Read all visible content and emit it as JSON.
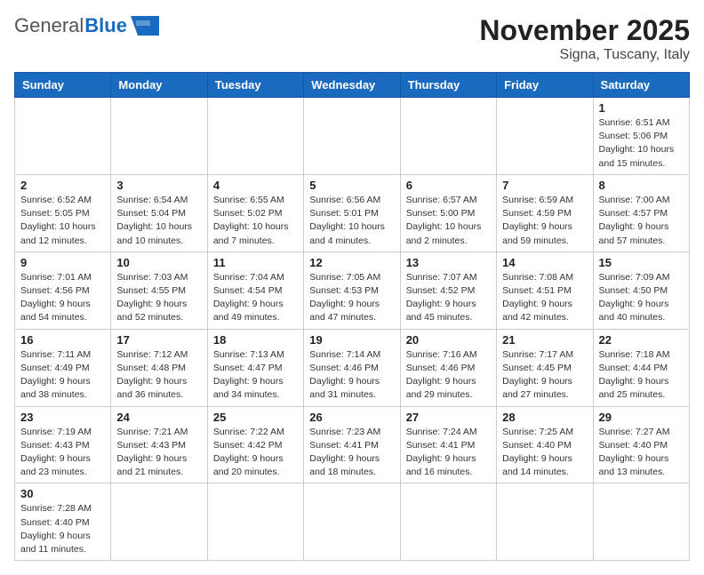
{
  "logo": {
    "general": "General",
    "blue": "Blue"
  },
  "title": "November 2025",
  "subtitle": "Signa, Tuscany, Italy",
  "weekdays": [
    "Sunday",
    "Monday",
    "Tuesday",
    "Wednesday",
    "Thursday",
    "Friday",
    "Saturday"
  ],
  "weeks": [
    [
      {
        "day": "",
        "info": ""
      },
      {
        "day": "",
        "info": ""
      },
      {
        "day": "",
        "info": ""
      },
      {
        "day": "",
        "info": ""
      },
      {
        "day": "",
        "info": ""
      },
      {
        "day": "",
        "info": ""
      },
      {
        "day": "1",
        "info": "Sunrise: 6:51 AM\nSunset: 5:06 PM\nDaylight: 10 hours and 15 minutes."
      }
    ],
    [
      {
        "day": "2",
        "info": "Sunrise: 6:52 AM\nSunset: 5:05 PM\nDaylight: 10 hours and 12 minutes."
      },
      {
        "day": "3",
        "info": "Sunrise: 6:54 AM\nSunset: 5:04 PM\nDaylight: 10 hours and 10 minutes."
      },
      {
        "day": "4",
        "info": "Sunrise: 6:55 AM\nSunset: 5:02 PM\nDaylight: 10 hours and 7 minutes."
      },
      {
        "day": "5",
        "info": "Sunrise: 6:56 AM\nSunset: 5:01 PM\nDaylight: 10 hours and 4 minutes."
      },
      {
        "day": "6",
        "info": "Sunrise: 6:57 AM\nSunset: 5:00 PM\nDaylight: 10 hours and 2 minutes."
      },
      {
        "day": "7",
        "info": "Sunrise: 6:59 AM\nSunset: 4:59 PM\nDaylight: 9 hours and 59 minutes."
      },
      {
        "day": "8",
        "info": "Sunrise: 7:00 AM\nSunset: 4:57 PM\nDaylight: 9 hours and 57 minutes."
      }
    ],
    [
      {
        "day": "9",
        "info": "Sunrise: 7:01 AM\nSunset: 4:56 PM\nDaylight: 9 hours and 54 minutes."
      },
      {
        "day": "10",
        "info": "Sunrise: 7:03 AM\nSunset: 4:55 PM\nDaylight: 9 hours and 52 minutes."
      },
      {
        "day": "11",
        "info": "Sunrise: 7:04 AM\nSunset: 4:54 PM\nDaylight: 9 hours and 49 minutes."
      },
      {
        "day": "12",
        "info": "Sunrise: 7:05 AM\nSunset: 4:53 PM\nDaylight: 9 hours and 47 minutes."
      },
      {
        "day": "13",
        "info": "Sunrise: 7:07 AM\nSunset: 4:52 PM\nDaylight: 9 hours and 45 minutes."
      },
      {
        "day": "14",
        "info": "Sunrise: 7:08 AM\nSunset: 4:51 PM\nDaylight: 9 hours and 42 minutes."
      },
      {
        "day": "15",
        "info": "Sunrise: 7:09 AM\nSunset: 4:50 PM\nDaylight: 9 hours and 40 minutes."
      }
    ],
    [
      {
        "day": "16",
        "info": "Sunrise: 7:11 AM\nSunset: 4:49 PM\nDaylight: 9 hours and 38 minutes."
      },
      {
        "day": "17",
        "info": "Sunrise: 7:12 AM\nSunset: 4:48 PM\nDaylight: 9 hours and 36 minutes."
      },
      {
        "day": "18",
        "info": "Sunrise: 7:13 AM\nSunset: 4:47 PM\nDaylight: 9 hours and 34 minutes."
      },
      {
        "day": "19",
        "info": "Sunrise: 7:14 AM\nSunset: 4:46 PM\nDaylight: 9 hours and 31 minutes."
      },
      {
        "day": "20",
        "info": "Sunrise: 7:16 AM\nSunset: 4:46 PM\nDaylight: 9 hours and 29 minutes."
      },
      {
        "day": "21",
        "info": "Sunrise: 7:17 AM\nSunset: 4:45 PM\nDaylight: 9 hours and 27 minutes."
      },
      {
        "day": "22",
        "info": "Sunrise: 7:18 AM\nSunset: 4:44 PM\nDaylight: 9 hours and 25 minutes."
      }
    ],
    [
      {
        "day": "23",
        "info": "Sunrise: 7:19 AM\nSunset: 4:43 PM\nDaylight: 9 hours and 23 minutes."
      },
      {
        "day": "24",
        "info": "Sunrise: 7:21 AM\nSunset: 4:43 PM\nDaylight: 9 hours and 21 minutes."
      },
      {
        "day": "25",
        "info": "Sunrise: 7:22 AM\nSunset: 4:42 PM\nDaylight: 9 hours and 20 minutes."
      },
      {
        "day": "26",
        "info": "Sunrise: 7:23 AM\nSunset: 4:41 PM\nDaylight: 9 hours and 18 minutes."
      },
      {
        "day": "27",
        "info": "Sunrise: 7:24 AM\nSunset: 4:41 PM\nDaylight: 9 hours and 16 minutes."
      },
      {
        "day": "28",
        "info": "Sunrise: 7:25 AM\nSunset: 4:40 PM\nDaylight: 9 hours and 14 minutes."
      },
      {
        "day": "29",
        "info": "Sunrise: 7:27 AM\nSunset: 4:40 PM\nDaylight: 9 hours and 13 minutes."
      }
    ],
    [
      {
        "day": "30",
        "info": "Sunrise: 7:28 AM\nSunset: 4:40 PM\nDaylight: 9 hours and 11 minutes."
      },
      {
        "day": "",
        "info": ""
      },
      {
        "day": "",
        "info": ""
      },
      {
        "day": "",
        "info": ""
      },
      {
        "day": "",
        "info": ""
      },
      {
        "day": "",
        "info": ""
      },
      {
        "day": "",
        "info": ""
      }
    ]
  ]
}
